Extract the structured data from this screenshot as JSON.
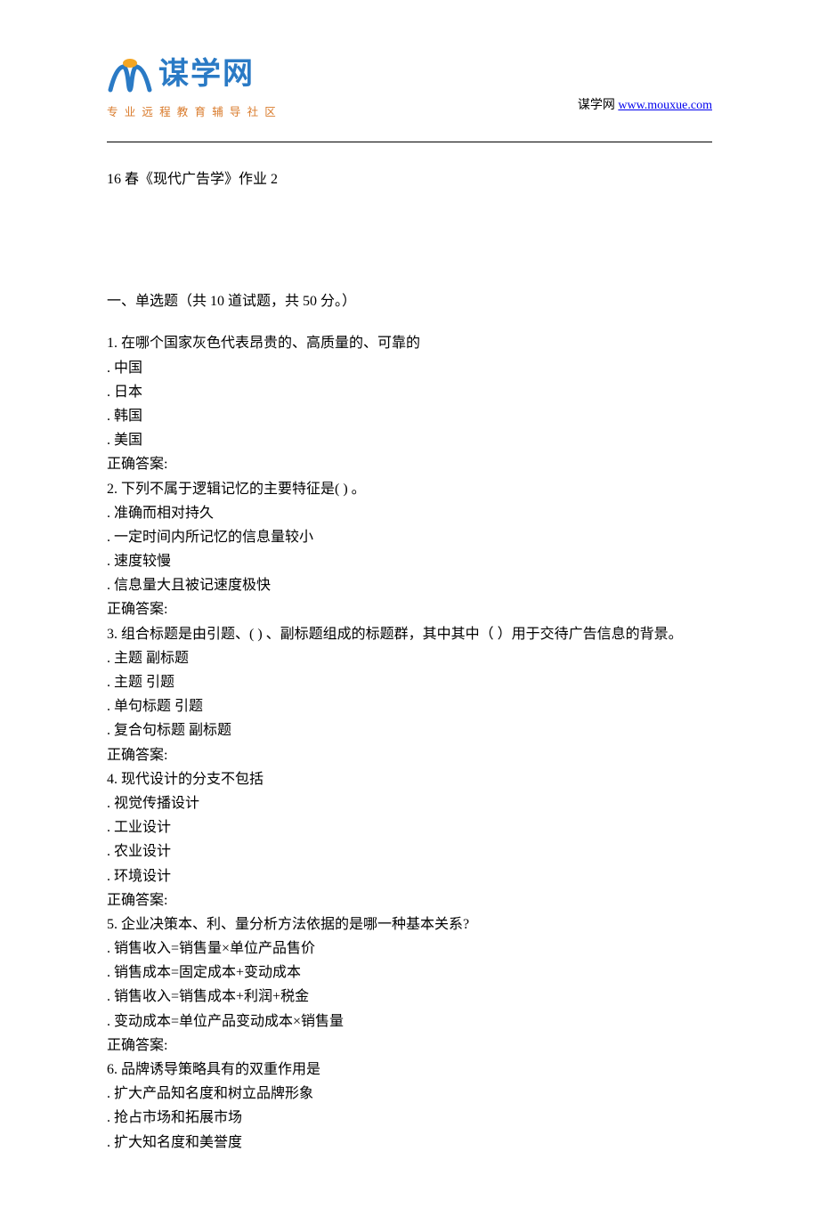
{
  "header": {
    "logo_text": "谋学网",
    "logo_url": "www.mouxue.com",
    "logo_tagline": "专业远程教育辅导社区",
    "site_label": "谋学网",
    "site_link": "www.mouxue.com"
  },
  "document": {
    "title": "16 春《现代广告学》作业 2",
    "section1_title": "一、单选题（共 10 道试题，共 50 分。）",
    "questions": [
      {
        "num": "1.",
        "stem": "  在哪个国家灰色代表昂贵的、高质量的、可靠的",
        "options": [
          ". 中国",
          ". 日本",
          ". 韩国",
          ". 美国"
        ],
        "answer_label": "正确答案:"
      },
      {
        "num": "2.",
        "stem": "  下列不属于逻辑记忆的主要特征是(  ) 。",
        "options": [
          ". 准确而相对持久",
          ". 一定时间内所记忆的信息量较小",
          ". 速度较慢",
          ". 信息量大且被记速度极快"
        ],
        "answer_label": "正确答案:"
      },
      {
        "num": "3.",
        "stem": "  组合标题是由引题、(  ) 、副标题组成的标题群，其中其中（  ）用于交待广告信息的背景。",
        "options": [
          ". 主题 副标题",
          ". 主题 引题",
          ". 单句标题 引题",
          ". 复合句标题 副标题"
        ],
        "answer_label": "正确答案:"
      },
      {
        "num": "4.",
        "stem": "  现代设计的分支不包括",
        "options": [
          ". 视觉传播设计",
          ". 工业设计",
          ". 农业设计",
          ". 环境设计"
        ],
        "answer_label": "正确答案:"
      },
      {
        "num": "5.",
        "stem": "  企业决策本、利、量分析方法依据的是哪一种基本关系?",
        "options": [
          ". 销售收入=销售量×单位产品售价",
          ". 销售成本=固定成本+变动成本",
          ". 销售收入=销售成本+利润+税金",
          ". 变动成本=单位产品变动成本×销售量"
        ],
        "answer_label": "正确答案:"
      },
      {
        "num": "6.",
        "stem": "  品牌诱导策略具有的双重作用是",
        "options": [
          ". 扩大产品知名度和树立品牌形象",
          ". 抢占市场和拓展市场",
          ". 扩大知名度和美誉度"
        ],
        "answer_label": ""
      }
    ]
  }
}
